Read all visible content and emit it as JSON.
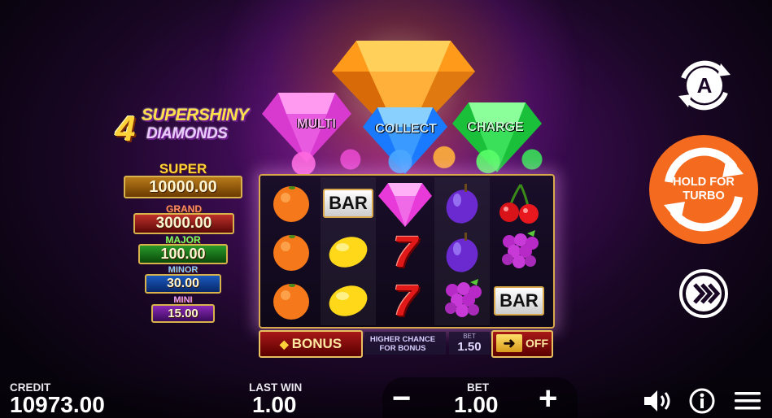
{
  "game": {
    "logo": {
      "number": "4",
      "line1": "SUPERSHINY",
      "line2": "DIAMONDS"
    }
  },
  "jackpots": [
    {
      "name": "SUPER",
      "value": "10000.00",
      "color": "#d8a84a"
    },
    {
      "name": "GRAND",
      "value": "3000.00",
      "color": "#c0302a"
    },
    {
      "name": "MAJOR",
      "value": "100.00",
      "color": "#2a9a2a"
    },
    {
      "name": "MINOR",
      "value": "30.00",
      "color": "#1a5ac0"
    },
    {
      "name": "MINI",
      "value": "15.00",
      "color": "#8a2ab8"
    }
  ],
  "diamonds": [
    {
      "label": "MULTI",
      "color": "#e040d0"
    },
    {
      "label": "COLLECT",
      "color": "#2a8aff"
    },
    {
      "label": "CHARGE",
      "color": "#2ad04a"
    }
  ],
  "reels": [
    [
      "orange",
      "orange",
      "orange"
    ],
    [
      "bar",
      "lemon",
      "lemon"
    ],
    [
      "diamond",
      "seven",
      "seven"
    ],
    [
      "plum",
      "plum",
      "grapes"
    ],
    [
      "cherry",
      "grapes",
      "bar"
    ]
  ],
  "symbols": {
    "bar_text": "BAR",
    "seven_text": "7"
  },
  "bonus": {
    "button_label": "BONUS",
    "higher_chance_line1": "HIGHER CHANCE",
    "higher_chance_line2": "FOR BONUS",
    "bet_label": "BET",
    "bet_value": "1.50",
    "toggle_label": "OFF"
  },
  "controls": {
    "turbo_line1": "HOLD FOR",
    "turbo_line2": "TURBO",
    "autoplay_letter": "A"
  },
  "status": {
    "credit_label": "CREDIT",
    "credit_value": "10973.00",
    "last_win_label": "LAST WIN",
    "last_win_value": "1.00",
    "bet_label": "BET",
    "bet_value": "1.00",
    "minus": "−",
    "plus": "+"
  },
  "colors": {
    "turbo": "#f46a1e",
    "accent_gold": "#d8a84a"
  }
}
